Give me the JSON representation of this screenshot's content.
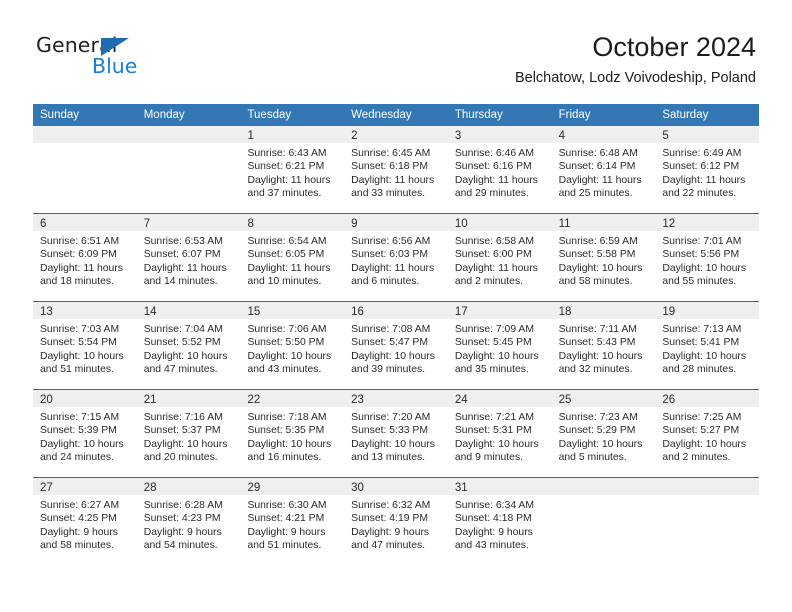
{
  "brand": {
    "name_top": "General",
    "name_bottom": "Blue",
    "color_primary": "#1a7fd4",
    "color_triangle": "#1f6cb0",
    "color_text": "#231f20"
  },
  "header": {
    "title": "October 2024",
    "subtitle": "Belchatow, Lodz Voivodeship, Poland"
  },
  "colors": {
    "header_row_bg": "#3378b5",
    "header_row_text": "#ffffff",
    "daynum_band_bg": "#efefef",
    "week_separator": "#2e6da4",
    "cell_bg": "#ffffff",
    "body_text": "#2b2b2b"
  },
  "weekdays": [
    "Sunday",
    "Monday",
    "Tuesday",
    "Wednesday",
    "Thursday",
    "Friday",
    "Saturday"
  ],
  "weeks": [
    [
      {
        "day": "",
        "lines": []
      },
      {
        "day": "",
        "lines": []
      },
      {
        "day": "1",
        "lines": [
          "Sunrise: 6:43 AM",
          "Sunset: 6:21 PM",
          "Daylight: 11 hours",
          "and 37 minutes."
        ]
      },
      {
        "day": "2",
        "lines": [
          "Sunrise: 6:45 AM",
          "Sunset: 6:18 PM",
          "Daylight: 11 hours",
          "and 33 minutes."
        ]
      },
      {
        "day": "3",
        "lines": [
          "Sunrise: 6:46 AM",
          "Sunset: 6:16 PM",
          "Daylight: 11 hours",
          "and 29 minutes."
        ]
      },
      {
        "day": "4",
        "lines": [
          "Sunrise: 6:48 AM",
          "Sunset: 6:14 PM",
          "Daylight: 11 hours",
          "and 25 minutes."
        ]
      },
      {
        "day": "5",
        "lines": [
          "Sunrise: 6:49 AM",
          "Sunset: 6:12 PM",
          "Daylight: 11 hours",
          "and 22 minutes."
        ]
      }
    ],
    [
      {
        "day": "6",
        "lines": [
          "Sunrise: 6:51 AM",
          "Sunset: 6:09 PM",
          "Daylight: 11 hours",
          "and 18 minutes."
        ]
      },
      {
        "day": "7",
        "lines": [
          "Sunrise: 6:53 AM",
          "Sunset: 6:07 PM",
          "Daylight: 11 hours",
          "and 14 minutes."
        ]
      },
      {
        "day": "8",
        "lines": [
          "Sunrise: 6:54 AM",
          "Sunset: 6:05 PM",
          "Daylight: 11 hours",
          "and 10 minutes."
        ]
      },
      {
        "day": "9",
        "lines": [
          "Sunrise: 6:56 AM",
          "Sunset: 6:03 PM",
          "Daylight: 11 hours",
          "and 6 minutes."
        ]
      },
      {
        "day": "10",
        "lines": [
          "Sunrise: 6:58 AM",
          "Sunset: 6:00 PM",
          "Daylight: 11 hours",
          "and 2 minutes."
        ]
      },
      {
        "day": "11",
        "lines": [
          "Sunrise: 6:59 AM",
          "Sunset: 5:58 PM",
          "Daylight: 10 hours",
          "and 58 minutes."
        ]
      },
      {
        "day": "12",
        "lines": [
          "Sunrise: 7:01 AM",
          "Sunset: 5:56 PM",
          "Daylight: 10 hours",
          "and 55 minutes."
        ]
      }
    ],
    [
      {
        "day": "13",
        "lines": [
          "Sunrise: 7:03 AM",
          "Sunset: 5:54 PM",
          "Daylight: 10 hours",
          "and 51 minutes."
        ]
      },
      {
        "day": "14",
        "lines": [
          "Sunrise: 7:04 AM",
          "Sunset: 5:52 PM",
          "Daylight: 10 hours",
          "and 47 minutes."
        ]
      },
      {
        "day": "15",
        "lines": [
          "Sunrise: 7:06 AM",
          "Sunset: 5:50 PM",
          "Daylight: 10 hours",
          "and 43 minutes."
        ]
      },
      {
        "day": "16",
        "lines": [
          "Sunrise: 7:08 AM",
          "Sunset: 5:47 PM",
          "Daylight: 10 hours",
          "and 39 minutes."
        ]
      },
      {
        "day": "17",
        "lines": [
          "Sunrise: 7:09 AM",
          "Sunset: 5:45 PM",
          "Daylight: 10 hours",
          "and 35 minutes."
        ]
      },
      {
        "day": "18",
        "lines": [
          "Sunrise: 7:11 AM",
          "Sunset: 5:43 PM",
          "Daylight: 10 hours",
          "and 32 minutes."
        ]
      },
      {
        "day": "19",
        "lines": [
          "Sunrise: 7:13 AM",
          "Sunset: 5:41 PM",
          "Daylight: 10 hours",
          "and 28 minutes."
        ]
      }
    ],
    [
      {
        "day": "20",
        "lines": [
          "Sunrise: 7:15 AM",
          "Sunset: 5:39 PM",
          "Daylight: 10 hours",
          "and 24 minutes."
        ]
      },
      {
        "day": "21",
        "lines": [
          "Sunrise: 7:16 AM",
          "Sunset: 5:37 PM",
          "Daylight: 10 hours",
          "and 20 minutes."
        ]
      },
      {
        "day": "22",
        "lines": [
          "Sunrise: 7:18 AM",
          "Sunset: 5:35 PM",
          "Daylight: 10 hours",
          "and 16 minutes."
        ]
      },
      {
        "day": "23",
        "lines": [
          "Sunrise: 7:20 AM",
          "Sunset: 5:33 PM",
          "Daylight: 10 hours",
          "and 13 minutes."
        ]
      },
      {
        "day": "24",
        "lines": [
          "Sunrise: 7:21 AM",
          "Sunset: 5:31 PM",
          "Daylight: 10 hours",
          "and 9 minutes."
        ]
      },
      {
        "day": "25",
        "lines": [
          "Sunrise: 7:23 AM",
          "Sunset: 5:29 PM",
          "Daylight: 10 hours",
          "and 5 minutes."
        ]
      },
      {
        "day": "26",
        "lines": [
          "Sunrise: 7:25 AM",
          "Sunset: 5:27 PM",
          "Daylight: 10 hours",
          "and 2 minutes."
        ]
      }
    ],
    [
      {
        "day": "27",
        "lines": [
          "Sunrise: 6:27 AM",
          "Sunset: 4:25 PM",
          "Daylight: 9 hours",
          "and 58 minutes."
        ]
      },
      {
        "day": "28",
        "lines": [
          "Sunrise: 6:28 AM",
          "Sunset: 4:23 PM",
          "Daylight: 9 hours",
          "and 54 minutes."
        ]
      },
      {
        "day": "29",
        "lines": [
          "Sunrise: 6:30 AM",
          "Sunset: 4:21 PM",
          "Daylight: 9 hours",
          "and 51 minutes."
        ]
      },
      {
        "day": "30",
        "lines": [
          "Sunrise: 6:32 AM",
          "Sunset: 4:19 PM",
          "Daylight: 9 hours",
          "and 47 minutes."
        ]
      },
      {
        "day": "31",
        "lines": [
          "Sunrise: 6:34 AM",
          "Sunset: 4:18 PM",
          "Daylight: 9 hours",
          "and 43 minutes."
        ]
      },
      {
        "day": "",
        "lines": []
      },
      {
        "day": "",
        "lines": []
      }
    ]
  ]
}
